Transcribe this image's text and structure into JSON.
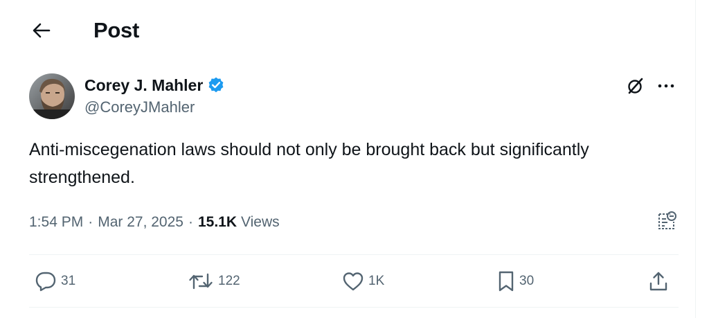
{
  "header": {
    "back_icon": "arrow-left-icon",
    "title": "Post"
  },
  "author": {
    "name": "Corey J. Mahler",
    "handle": "@CoreyJMahler",
    "verified": true,
    "verified_color": "#1d9bf0"
  },
  "tweet": {
    "text": "Anti-miscegenation laws should not only be brought back but significantly strengthened."
  },
  "meta": {
    "time": "1:54 PM",
    "date": "Mar 27, 2025",
    "separator": "·",
    "views_count": "15.1K",
    "views_label": "Views"
  },
  "actions": {
    "replies": "31",
    "reposts": "122",
    "likes": "1K",
    "bookmarks": "30"
  },
  "colors": {
    "text": "#0f1419",
    "secondary": "#536471",
    "divider": "#eff3f4",
    "accent": "#1d9bf0"
  },
  "icons": [
    "arrow-left-icon",
    "verified-badge-icon",
    "grok-icon",
    "more-icon",
    "analytics-icon",
    "reply-icon",
    "repost-icon",
    "like-icon",
    "bookmark-icon",
    "share-icon"
  ]
}
